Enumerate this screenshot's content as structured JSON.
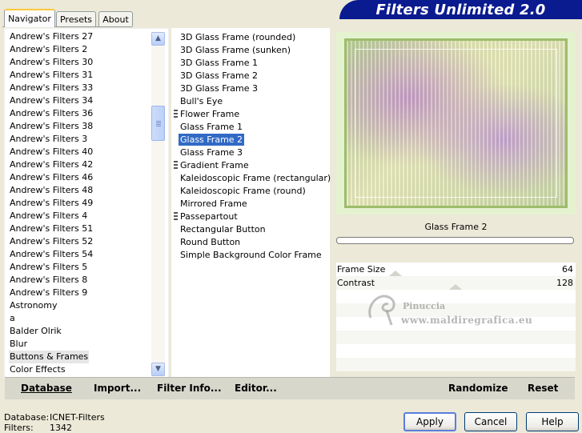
{
  "tabs": [
    {
      "label": "Navigator",
      "active": true
    },
    {
      "label": "Presets",
      "active": false
    },
    {
      "label": "About",
      "active": false
    }
  ],
  "banner": {
    "title": "Filters Unlimited 2.0",
    "color": "#0a1a8f"
  },
  "navigator": {
    "items": [
      "Andrew's Filters 27",
      "Andrew's Filters 2",
      "Andrew's Filters 30",
      "Andrew's Filters 31",
      "Andrew's Filters 33",
      "Andrew's Filters 34",
      "Andrew's Filters 36",
      "Andrew's Filters 38",
      "Andrew's Filters 3",
      "Andrew's Filters 40",
      "Andrew's Filters 42",
      "Andrew's Filters 46",
      "Andrew's Filters 48",
      "Andrew's Filters 49",
      "Andrew's Filters 4",
      "Andrew's Filters 51",
      "Andrew's Filters 52",
      "Andrew's Filters 54",
      "Andrew's Filters 5",
      "Andrew's Filters 8",
      "Andrew's Filters 9",
      "Astronomy",
      "a",
      "Balder Olrik",
      "Blur",
      "Buttons & Frames",
      "Color Effects"
    ],
    "selected": "Buttons & Frames",
    "scrollbar": {
      "up_icon": "arrow-up-icon",
      "down_icon": "arrow-down-icon"
    }
  },
  "filters": {
    "items": [
      {
        "label": "3D Glass Frame (rounded)",
        "marker": false
      },
      {
        "label": "3D Glass Frame (sunken)",
        "marker": false
      },
      {
        "label": "3D Glass Frame 1",
        "marker": false
      },
      {
        "label": "3D Glass Frame 2",
        "marker": false
      },
      {
        "label": "3D Glass Frame 3",
        "marker": false
      },
      {
        "label": "Bull's Eye",
        "marker": false
      },
      {
        "label": "Flower Frame",
        "marker": true
      },
      {
        "label": "Glass Frame 1",
        "marker": false
      },
      {
        "label": "Glass Frame 2",
        "marker": false
      },
      {
        "label": "Glass Frame 3",
        "marker": false
      },
      {
        "label": "Gradient Frame",
        "marker": true
      },
      {
        "label": "Kaleidoscopic Frame (rectangular)",
        "marker": false
      },
      {
        "label": "Kaleidoscopic Frame (round)",
        "marker": false
      },
      {
        "label": "Mirrored Frame",
        "marker": false
      },
      {
        "label": "Passepartout",
        "marker": true
      },
      {
        "label": "Rectangular Button",
        "marker": false
      },
      {
        "label": "Round Button",
        "marker": false
      },
      {
        "label": "Simple Background Color Frame",
        "marker": false
      }
    ],
    "selected": "Glass Frame 2",
    "selection_color": "#316ac5"
  },
  "preview": {
    "filter_name": "Glass Frame 2"
  },
  "params": [
    {
      "label": "Frame Size",
      "value": "64"
    },
    {
      "label": "Contrast",
      "value": "128"
    }
  ],
  "watermark": {
    "line1": "Pinuccia",
    "line2": "www.maldiregrafica.eu"
  },
  "toolbar": {
    "database": "Database",
    "import": "Import...",
    "filter_info": "Filter Info...",
    "editor": "Editor...",
    "randomize": "Randomize",
    "reset": "Reset"
  },
  "status": {
    "database_label": "Database:",
    "database_value": "ICNET-Filters",
    "filters_label": "Filters:",
    "filters_value": "1342"
  },
  "buttons": {
    "apply": "Apply",
    "cancel": "Cancel",
    "help": "Help"
  }
}
